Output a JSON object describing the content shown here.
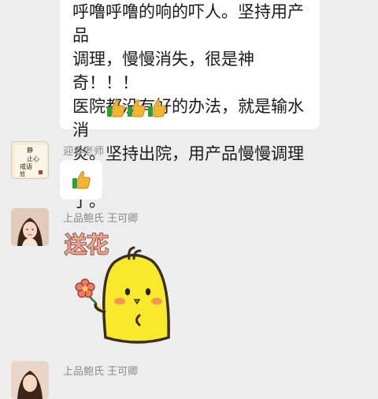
{
  "messages": [
    {
      "text_lines": "呼噜呼噜的响的吓人。坚持用产品\n调理，慢慢消失，很是神奇！！！\n医院都没有好的办法，就是输水消\n炎。坚持出院，用产品慢慢调理好\n了。",
      "emoji": [
        "thumbs-up",
        "thumbs-up",
        "thumbs-up"
      ]
    },
    {
      "sender": "迎春老师",
      "avatar_text": [
        "静",
        "止心",
        "戒语",
        "怒"
      ],
      "emoji": [
        "thumbs-up"
      ]
    },
    {
      "sender": "上品鲍氏 王可卿",
      "sticker": {
        "caption": "送花",
        "character": "yellow-chick"
      }
    },
    {
      "sender": "上品鲍氏 王可卿"
    }
  ],
  "colors": {
    "background": "#ededed",
    "bubble": "#ffffff",
    "sender_text": "#8a8a8a",
    "sticker_yellow": "#f8ea2b"
  }
}
